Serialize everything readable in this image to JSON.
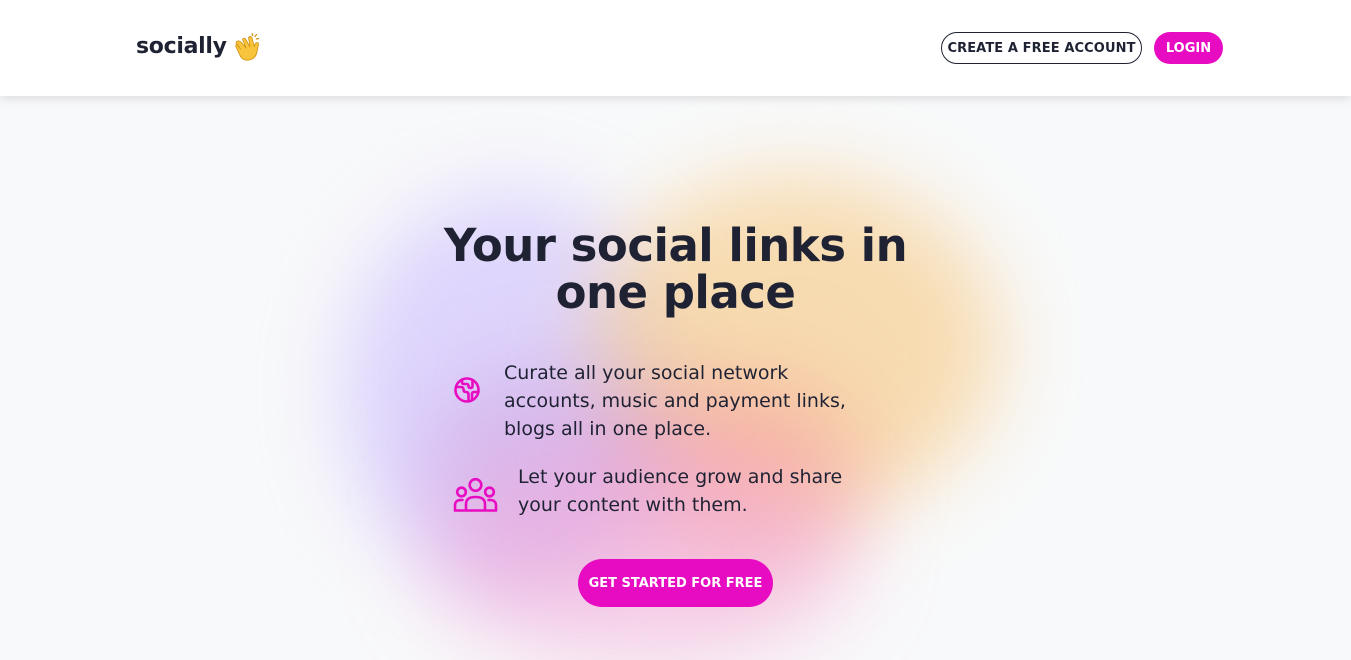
{
  "brand": {
    "name": "socially",
    "icon": "clapping-hands-icon"
  },
  "nav": {
    "create_account_label": "CREATE A FREE ACCOUNT",
    "login_label": "LOGIN"
  },
  "hero": {
    "title": "Your social links in one place",
    "features": [
      {
        "icon": "globe-icon",
        "text": "Curate all your social network accounts, music and payment links, blogs all in one place."
      },
      {
        "icon": "users-group-icon",
        "text": "Let your audience grow and share your content with them."
      }
    ],
    "cta_label": "GET STARTED FOR FREE"
  },
  "colors": {
    "accent": "#e70bc1",
    "text": "#1e2233",
    "background": "#f8f9fa"
  }
}
